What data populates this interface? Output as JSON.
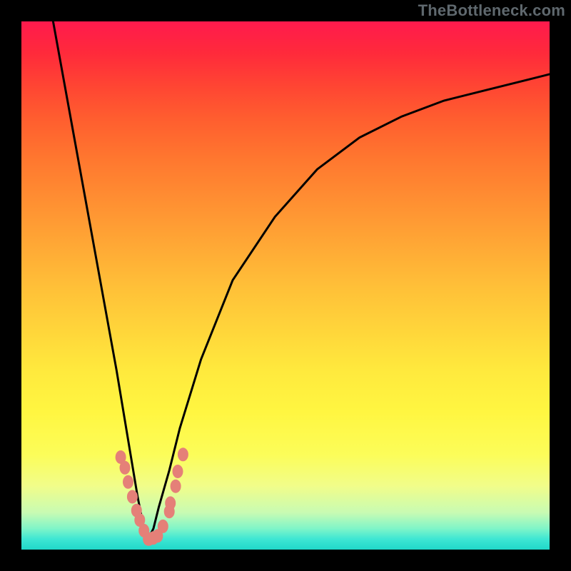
{
  "watermark": "TheBottleneck.com",
  "colors": {
    "frame": "#000000",
    "curve": "#000000",
    "dots": "#e58078",
    "gradient_top": "#ff1a4d",
    "gradient_bottom": "#20d8c9"
  },
  "chart_data": {
    "type": "line",
    "title": "",
    "xlabel": "",
    "ylabel": "",
    "xlim": [
      0,
      100
    ],
    "ylim": [
      0,
      100
    ],
    "grid": false,
    "legend": false,
    "annotations": [
      "TheBottleneck.com"
    ],
    "description": "Bottleneck-style V-curve over a vertical red-to-green gradient; minimum near x≈24 with salmon scatter dots clustered along the curve near y≈2–18.",
    "series": [
      {
        "name": "curve",
        "style": "line",
        "color": "#000000",
        "x": [
          6,
          8,
          10,
          12,
          14,
          16,
          18,
          20,
          22,
          23,
          24,
          25,
          26,
          28,
          30,
          34,
          40,
          48,
          56,
          64,
          72,
          80,
          88,
          96,
          100
        ],
        "y": [
          100,
          89,
          78,
          67,
          56,
          45,
          34,
          22,
          10,
          5,
          2,
          4,
          8,
          15,
          23,
          36,
          51,
          63,
          72,
          78,
          82,
          85,
          87,
          89,
          90
        ]
      },
      {
        "name": "points",
        "style": "scatter",
        "color": "#e58078",
        "x": [
          18.8,
          19.6,
          20.2,
          21.0,
          21.8,
          22.4,
          23.2,
          24.0,
          24.2,
          25.0,
          25.8,
          26.8,
          28.0,
          28.2,
          29.2,
          29.6,
          30.6
        ],
        "y": [
          17.5,
          15.5,
          12.8,
          10.0,
          7.4,
          5.6,
          3.6,
          2.0,
          2.0,
          2.2,
          2.6,
          4.4,
          7.2,
          8.8,
          12.0,
          14.8,
          18.0
        ]
      }
    ]
  }
}
